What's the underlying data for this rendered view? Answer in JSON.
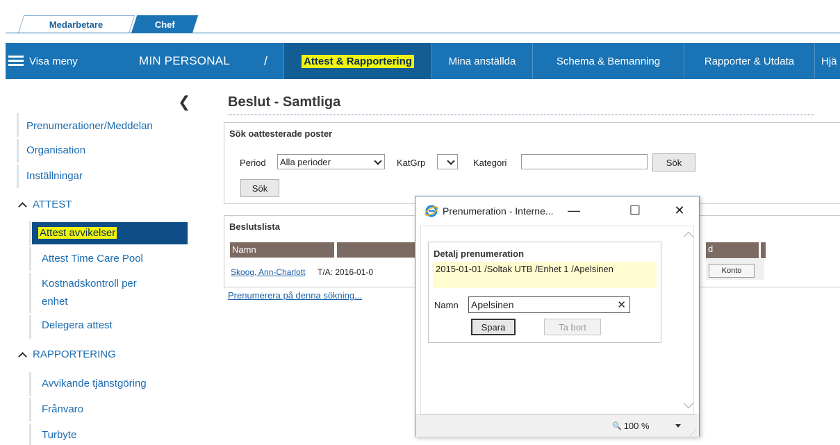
{
  "top_tabs": {
    "medarbetare": "Medarbetare",
    "chef": "Chef"
  },
  "navbar": {
    "menu_label": "Visa meny",
    "title": "MIN PERSONAL",
    "separator": "/",
    "items": [
      "Attest & Rapportering",
      "Mina anställda",
      "Schema & Bemanning",
      "Rapporter & Utdata",
      "Hjä"
    ]
  },
  "sidebar": {
    "collapse_glyph": "❮",
    "top_items": [
      "Prenumerationer/Meddelan",
      "Organisation",
      "Inställningar"
    ],
    "attest_header": "ATTEST",
    "attest_items": [
      "Attest avvikelser",
      "Attest Time Care Pool",
      "Kostnadskontroll per",
      "enhet",
      "Delegera attest"
    ],
    "rapportering_header": "RAPPORTERING",
    "rapportering_items": [
      "Avvikande tjänstgöring",
      "Frånvaro",
      "Turbyte"
    ]
  },
  "main": {
    "title": "Beslut - Samtliga",
    "search": {
      "header": "Sök oattesterade poster",
      "period_label": "Period",
      "period_value": "Alla perioder",
      "katgrp_label": "KatGrp",
      "kategori_label": "Kategori",
      "search_button": "Sök",
      "search_button2": "Sök"
    },
    "list": {
      "header": "Beslutslista",
      "col_name": "Namn",
      "row_name": "Skoog, Ann-Charlott",
      "row_text": "T/A: 2016-01-0",
      "col_d": "d",
      "konto_button": "Konto"
    },
    "subscribe_link": "Prenumerera på denna sökning..."
  },
  "popup": {
    "title": "Prenumeration - Interne...",
    "minimize": "—",
    "maximize": "☐",
    "close": "✕",
    "detail_header": "Detalj prenumeration",
    "detail_text": "2015-01-01 /Soltak UTB /Enhet 1 /Apelsinen",
    "name_label": "Namn",
    "name_value": "Apelsinen",
    "clear_glyph": "✕",
    "save_button": "Spara",
    "delete_button": "Ta bort",
    "zoom_level": "100 %",
    "zoom_glyph": "🔍"
  },
  "colors": {
    "nav_blue": "#1a73b5",
    "highlight": "#f1f40f",
    "table_head": "#7c6b62"
  }
}
